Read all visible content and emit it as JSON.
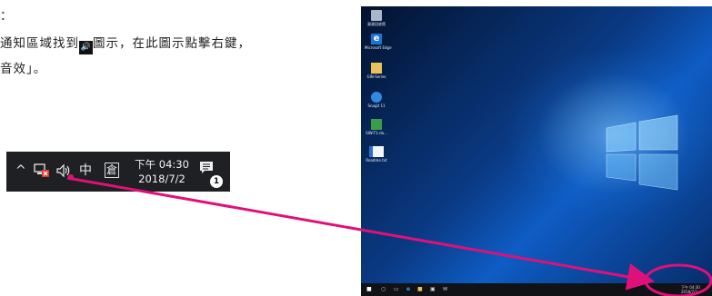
{
  "manual": {
    "line1": "：",
    "line2_before": "通知區域找到",
    "line2_icon": "🔊",
    "line2_after": "圖示，在此圖示點擊右鍵，",
    "line3": "音效」。"
  },
  "taskbar_zoom": {
    "chevron": "^",
    "network_icon": "network-error-icon",
    "speaker_icon": "speaker-icon",
    "ime_label": "中",
    "ime2_label": "倉",
    "clock_time": "下午 04:30",
    "clock_date": "2018/7/2",
    "notification_count": "1"
  },
  "desktop": {
    "icons": [
      {
        "label": "資源回收筒"
      },
      {
        "label": "Microsoft Edge"
      },
      {
        "label": "GIN-Series"
      },
      {
        "label": "Snagit 11"
      },
      {
        "label": "SIW-T1-da..."
      },
      {
        "label": "Readme.txt"
      }
    ],
    "taskbar_clock": "下午 04:30 2018/7/2"
  },
  "colors": {
    "arrow": "#e0107a",
    "taskbar": "#1f2023",
    "desktop_blue": "#0e5cc4"
  }
}
